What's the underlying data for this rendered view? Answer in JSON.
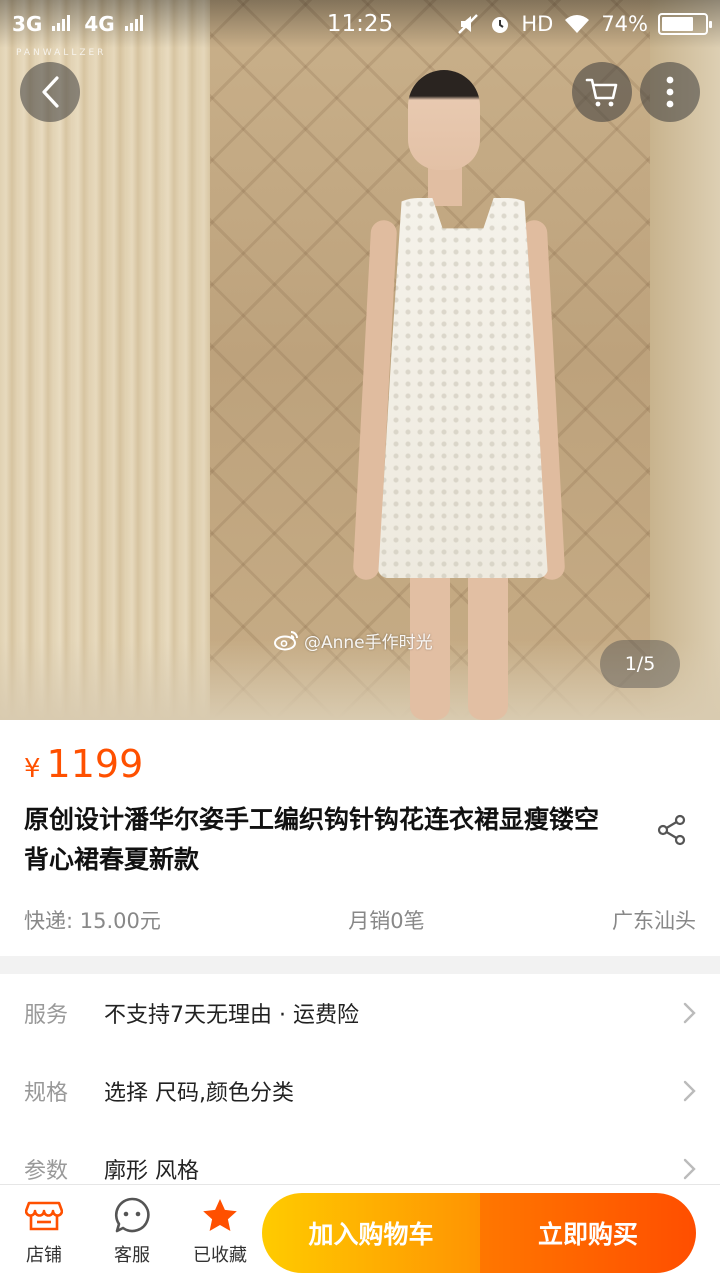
{
  "status_bar": {
    "network_1": "3G",
    "network_2": "4G",
    "time": "11:25",
    "hd": "HD",
    "battery_percent": "74%",
    "battery_level": 0.74
  },
  "hero": {
    "brand_mark": "PANWALLZER",
    "watermark": "@Anne手作时光",
    "pager": "1/5"
  },
  "product": {
    "currency": "¥",
    "price": "1199",
    "title": "原创设计潘华尔姿手工编织钩针钩花连衣裙显瘦镂空背心裙春夏新款",
    "shipping": "快递: 15.00元",
    "monthly_sales": "月销0笔",
    "location": "广东汕头"
  },
  "rows": [
    {
      "label": "服务",
      "value": "不支持7天无理由 · 运费险"
    },
    {
      "label": "规格",
      "value": "选择 尺码,颜色分类"
    },
    {
      "label": "参数",
      "value": "廓形 风格"
    }
  ],
  "bottom_bar": {
    "shop_label": "店铺",
    "service_label": "客服",
    "favorite_label": "已收藏",
    "add_to_cart": "加入购物车",
    "buy_now": "立即购买"
  },
  "colors": {
    "accent": "#ff5000",
    "cart_gradient_start": "#ffcb00",
    "buy_gradient_end": "#ff4e00"
  }
}
